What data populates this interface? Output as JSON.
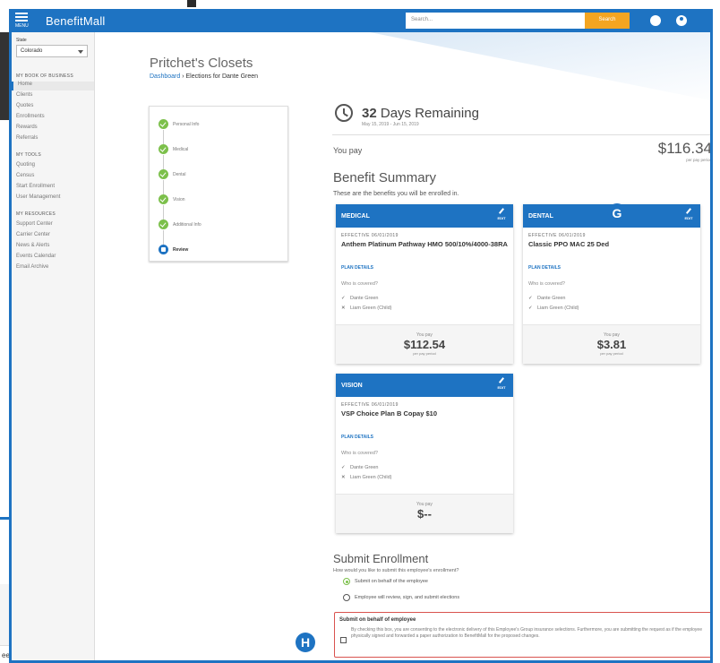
{
  "header": {
    "menu_label": "MENU",
    "brand": "BenefitMall",
    "search_placeholder": "Search...",
    "search_button": "Search"
  },
  "sidebar": {
    "state_label": "State",
    "state_value": "Colorado",
    "book_title": "MY BOOK OF BUSINESS",
    "book_items": [
      "Home",
      "Clients",
      "Quotes",
      "Enrollments",
      "Rewards",
      "Referrals"
    ],
    "tools_title": "MY TOOLS",
    "tools_items": [
      "Quoting",
      "Census",
      "Start Enrollment",
      "User Management"
    ],
    "resources_title": "MY RESOURCES",
    "resources_items": [
      "Support Center",
      "Carrier Center",
      "News & Alerts",
      "Events Calendar",
      "Email Archive"
    ]
  },
  "page": {
    "company": "Pritchet's Closets",
    "breadcrumb_link": "Dashboard",
    "breadcrumb_sep": "›",
    "breadcrumb_current": "Elections for Dante Green"
  },
  "steps": [
    "Personal Info",
    "Medical",
    "Dental",
    "Vision",
    "Additional Info",
    "Review"
  ],
  "summary": {
    "days_count": "32",
    "days_label": "Days Remaining",
    "range": "May 15, 2019 - Jun 15, 2019",
    "you_pay_label": "You pay",
    "total": "$116.34",
    "per_pay": "per pay period",
    "title": "Benefit Summary",
    "subtitle": "These are the benefits you will be enrolled in."
  },
  "cards": {
    "edit_label": "EDIT",
    "plan_details": "PLAN DETAILS",
    "who_covered": "Who is covered?",
    "you_pay": "You pay",
    "per_pay": "per pay period",
    "medical": {
      "title": "MEDICAL",
      "effective": "EFFECTIVE 06/01/2019",
      "plan": "Anthem Platinum Pathway HMO 500/10%/4000-38RA",
      "members": [
        {
          "sym": "✓",
          "name": "Dante Green"
        },
        {
          "sym": "✕",
          "name": "Liam Green (Child)"
        }
      ],
      "amount": "$112.54"
    },
    "dental": {
      "title": "DENTAL",
      "effective": "EFFECTIVE 06/01/2019",
      "plan": "Classic PPO MAC 25 Ded",
      "members": [
        {
          "sym": "✓",
          "name": "Dante Green"
        },
        {
          "sym": "✓",
          "name": "Liam Green (Child)"
        }
      ],
      "amount": "$3.81"
    },
    "vision": {
      "title": "VISION",
      "effective": "EFFECTIVE 06/01/2019",
      "plan": "VSP Choice Plan B Copay $10",
      "members": [
        {
          "sym": "✓",
          "name": "Dante Green"
        },
        {
          "sym": "✕",
          "name": "Liam Green (Child)"
        }
      ],
      "amount": "$--"
    }
  },
  "submit": {
    "title": "Submit Enrollment",
    "question": "How would you like to submit this employee's enrollment?",
    "option1": "Submit on behalf of the employee",
    "option2": "Employee will review, sign, and submit elections",
    "consent_title": "Submit on behalf of employee",
    "consent_text": "By checking this box, you are consenting to the electronic delivery of this Employee's Group insurance selections. Furthermore, you are submitting the request as if the employee physically signed and forwarded a paper authorization to BenefitMall for the proposed changes."
  },
  "background": {
    "row_text": "een"
  },
  "markers": {
    "g": "G",
    "h": "H"
  }
}
